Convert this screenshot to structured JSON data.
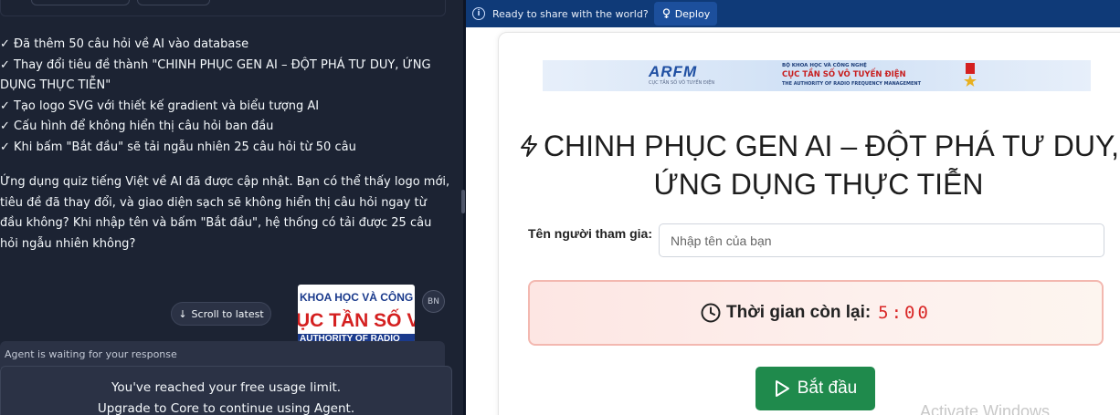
{
  "left_pane": {
    "checklist": [
      "✓ Đã thêm 50 câu hỏi về AI vào database",
      "✓ Thay đổi tiêu đề thành \"CHINH PHỤC GEN AI – ĐỘT PHÁ TƯ DUY, ỨNG DỤNG THỰC TIỄN\"",
      "✓ Tạo logo SVG với thiết kế gradient và biểu tượng AI",
      "✓ Cấu hình để không hiển thị câu hỏi ban đầu",
      "✓ Khi bấm \"Bắt đầu\" sẽ tải ngẫu nhiên 25 câu hỏi từ 50 câu"
    ],
    "summary": "Ứng dụng quiz tiếng Việt về AI đã được cập nhật. Bạn có thể thấy logo mới, tiêu đề đã thay đổi, và giao diện sạch sẽ không hiển thị câu hỏi ngay từ đầu không? Khi nhập tên và bấm \"Bắt đầu\", hệ thống có tải được 25 câu hỏi ngẫu nhiên không?",
    "scroll_button": "Scroll to latest",
    "thumbnail": {
      "line1": "KHOA HỌC VÀ CÔNG",
      "line2": "ỤC TẦN SỐ VÔ",
      "line3": "AUTHORITY OF RADIO"
    },
    "avatar_initials": "BN",
    "waiting_text": "Agent is waiting for your response",
    "limit_line1": "You've reached your free usage limit.",
    "limit_line2": "Upgrade to Core to continue using Agent."
  },
  "right_pane": {
    "banner_text": "Ready to share with the world?",
    "deploy_label": "Deploy",
    "logo": {
      "arfm": "ARFM",
      "arfm_sub": "CỤC TẦN SỐ VÔ TUYẾN ĐIỆN",
      "org_line1": "BỘ KHOA HỌC VÀ CÔNG NGHỆ",
      "org_line2": "CỤC TẦN SỐ VÔ TUYẾN ĐIỆN",
      "org_line3": "THE AUTHORITY OF RADIO FREQUENCY MANAGEMENT"
    },
    "title": "CHINH PHỤC GEN AI – ĐỘT PHÁ TƯ DUY, ỨNG DỤNG THỰC TIỄN",
    "name_label": "Tên người tham gia:",
    "name_placeholder": "Nhập tên của bạn",
    "timer_label": "Thời gian còn lại:",
    "timer_value": "5:00",
    "start_label": "Bắt đầu",
    "watermark": "Activate Windows"
  }
}
